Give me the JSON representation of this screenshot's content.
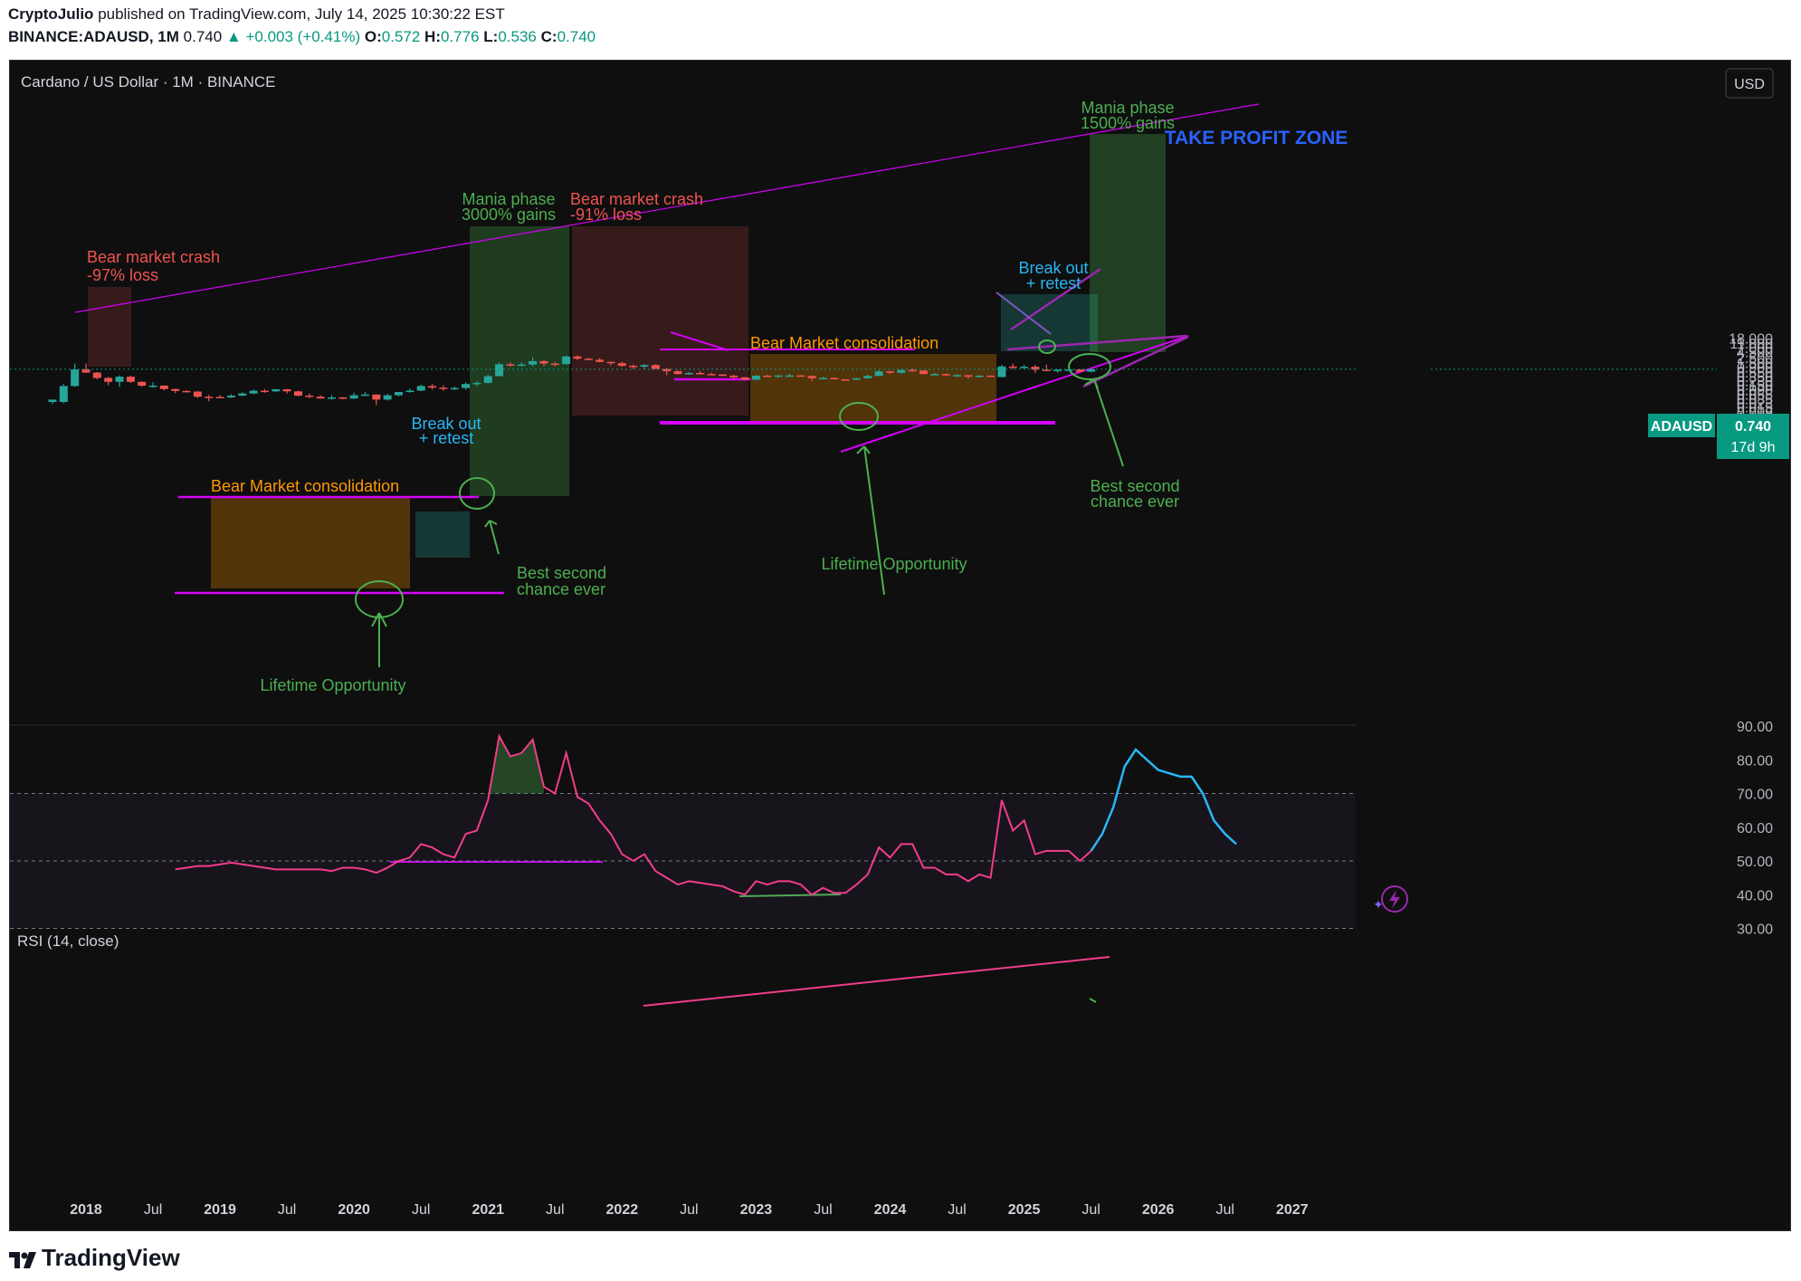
{
  "header": {
    "line1_author": "CryptoJulio",
    "line1_rest": "published on TradingView.com, July 14, 2025 10:30:22 EST",
    "symbol": "BINANCE:ADAUSD, 1M",
    "price": "0.740",
    "change": "+0.003 (+0.41%)",
    "o_label": "O:",
    "o": "0.572",
    "h_label": "H:",
    "h": "0.776",
    "l_label": "L:",
    "l": "0.536",
    "c_label": "C:",
    "c": "0.740"
  },
  "legend_title": "Cardano / US Dollar · 1M · BINANCE",
  "currency_button": "USD",
  "price_badge": {
    "symbol": "ADAUSD",
    "value": "0.740",
    "countdown": "17d 9h"
  },
  "rsi_title": "RSI (14, close)",
  "footer_brand": "TradingView",
  "colors": {
    "up": "#26a69a",
    "down": "#ef5350",
    "rsi": "#f23d8a",
    "rsi_projection": "#29b6f6",
    "trend": "#d500f9",
    "annotation_green": "#4caf50",
    "annotation_red": "#ef5350",
    "annotation_orange": "#ff9800",
    "annotation_cyan": "#29b6f6",
    "take_profit": "#2962ff"
  },
  "annotations": [
    {
      "text": "Bear market crash",
      "color": "red"
    },
    {
      "text": "-97% loss",
      "color": "red"
    },
    {
      "text": "Bear Market consolidation",
      "color": "orange"
    },
    {
      "text": "Break out",
      "color": "cyan"
    },
    {
      "text": "+ retest",
      "color": "cyan"
    },
    {
      "text": "Mania phase",
      "color": "green"
    },
    {
      "text": "3000% gains",
      "color": "green"
    },
    {
      "text": "Bear market crash",
      "color": "red"
    },
    {
      "text": "-91% loss",
      "color": "red"
    },
    {
      "text": "Best second",
      "color": "green"
    },
    {
      "text": "chance ever",
      "color": "green"
    },
    {
      "text": "Lifetime Opportunity",
      "color": "green"
    },
    {
      "text": "Bear Market consolidation",
      "color": "orange"
    },
    {
      "text": "Lifetime Opportunity",
      "color": "green"
    },
    {
      "text": "Break out",
      "color": "cyan"
    },
    {
      "text": "+ retest",
      "color": "cyan"
    },
    {
      "text": "Mania phase",
      "color": "green"
    },
    {
      "text": "1500% gains",
      "color": "green"
    },
    {
      "text": "TAKE PROFIT ZONE",
      "color": "blue"
    },
    {
      "text": "Best second",
      "color": "green"
    },
    {
      "text": "chance ever",
      "color": "green"
    }
  ],
  "chart_data": {
    "type": "candlestick",
    "title": "Cardano / US Dollar · 1M · BINANCE",
    "y_scale": "log",
    "y_ticks": [
      "18.000",
      "11.000",
      "7.000",
      "4.500",
      "2.500",
      "1.500",
      "0.900",
      "0.550",
      "0.350",
      "0.230",
      "0.150",
      "0.090",
      "0.055",
      "0.035",
      "0.023",
      "0.015",
      "0.009",
      "0.005"
    ],
    "x_ticks": [
      "2018",
      "Jul",
      "2019",
      "Jul",
      "2020",
      "Jul",
      "2021",
      "Jul",
      "2022",
      "Jul",
      "2023",
      "Jul",
      "2024",
      "Jul",
      "2025",
      "Jul",
      "2026",
      "Jul",
      "2027"
    ],
    "candles": [
      {
        "d": "2017-10",
        "o": 0.025,
        "h": 0.03,
        "l": 0.02,
        "c": 0.032
      },
      {
        "d": "2017-11",
        "o": 0.025,
        "h": 0.16,
        "l": 0.022,
        "c": 0.13
      },
      {
        "d": "2017-12",
        "o": 0.13,
        "h": 1.33,
        "l": 0.12,
        "c": 0.72
      },
      {
        "d": "2018-01",
        "o": 0.72,
        "h": 1.33,
        "l": 0.5,
        "c": 0.52
      },
      {
        "d": "2018-02",
        "o": 0.52,
        "h": 0.55,
        "l": 0.26,
        "c": 0.3
      },
      {
        "d": "2018-03",
        "o": 0.3,
        "h": 0.34,
        "l": 0.14,
        "c": 0.2
      },
      {
        "d": "2018-04",
        "o": 0.2,
        "h": 0.39,
        "l": 0.12,
        "c": 0.34
      },
      {
        "d": "2018-05",
        "o": 0.34,
        "h": 0.38,
        "l": 0.18,
        "c": 0.2
      },
      {
        "d": "2018-06",
        "o": 0.2,
        "h": 0.21,
        "l": 0.12,
        "c": 0.135
      },
      {
        "d": "2018-07",
        "o": 0.135,
        "h": 0.19,
        "l": 0.11,
        "c": 0.135
      },
      {
        "d": "2018-08",
        "o": 0.135,
        "h": 0.14,
        "l": 0.083,
        "c": 0.095
      },
      {
        "d": "2018-09",
        "o": 0.095,
        "h": 0.1,
        "l": 0.063,
        "c": 0.078
      },
      {
        "d": "2018-10",
        "o": 0.078,
        "h": 0.085,
        "l": 0.07,
        "c": 0.073
      },
      {
        "d": "2018-11",
        "o": 0.073,
        "h": 0.078,
        "l": 0.038,
        "c": 0.043
      },
      {
        "d": "2018-12",
        "o": 0.043,
        "h": 0.052,
        "l": 0.027,
        "c": 0.042
      },
      {
        "d": "2019-01",
        "o": 0.042,
        "h": 0.051,
        "l": 0.039,
        "c": 0.04
      },
      {
        "d": "2019-02",
        "o": 0.04,
        "h": 0.055,
        "l": 0.038,
        "c": 0.048
      },
      {
        "d": "2019-03",
        "o": 0.048,
        "h": 0.068,
        "l": 0.046,
        "c": 0.06
      },
      {
        "d": "2019-04",
        "o": 0.06,
        "h": 0.09,
        "l": 0.057,
        "c": 0.08
      },
      {
        "d": "2019-05",
        "o": 0.08,
        "h": 0.095,
        "l": 0.065,
        "c": 0.075
      },
      {
        "d": "2019-06",
        "o": 0.075,
        "h": 0.095,
        "l": 0.07,
        "c": 0.093
      },
      {
        "d": "2019-07",
        "o": 0.093,
        "h": 0.095,
        "l": 0.06,
        "c": 0.075
      },
      {
        "d": "2019-08",
        "o": 0.075,
        "h": 0.08,
        "l": 0.045,
        "c": 0.048
      },
      {
        "d": "2019-09",
        "o": 0.048,
        "h": 0.06,
        "l": 0.038,
        "c": 0.043
      },
      {
        "d": "2019-10",
        "o": 0.043,
        "h": 0.05,
        "l": 0.035,
        "c": 0.036
      },
      {
        "d": "2019-11",
        "o": 0.036,
        "h": 0.05,
        "l": 0.032,
        "c": 0.04
      },
      {
        "d": "2019-12",
        "o": 0.04,
        "h": 0.042,
        "l": 0.033,
        "c": 0.036
      },
      {
        "d": "2020-01",
        "o": 0.036,
        "h": 0.065,
        "l": 0.033,
        "c": 0.05
      },
      {
        "d": "2020-02",
        "o": 0.05,
        "h": 0.072,
        "l": 0.048,
        "c": 0.054
      },
      {
        "d": "2020-03",
        "o": 0.054,
        "h": 0.055,
        "l": 0.018,
        "c": 0.032
      },
      {
        "d": "2020-04",
        "o": 0.032,
        "h": 0.058,
        "l": 0.029,
        "c": 0.05
      },
      {
        "d": "2020-05",
        "o": 0.05,
        "h": 0.062,
        "l": 0.045,
        "c": 0.07
      },
      {
        "d": "2020-06",
        "o": 0.07,
        "h": 0.1,
        "l": 0.065,
        "c": 0.081
      },
      {
        "d": "2020-07",
        "o": 0.081,
        "h": 0.15,
        "l": 0.076,
        "c": 0.13
      },
      {
        "d": "2020-08",
        "o": 0.13,
        "h": 0.16,
        "l": 0.09,
        "c": 0.11
      },
      {
        "d": "2020-09",
        "o": 0.11,
        "h": 0.14,
        "l": 0.08,
        "c": 0.103
      },
      {
        "d": "2020-10",
        "o": 0.103,
        "h": 0.12,
        "l": 0.085,
        "c": 0.106
      },
      {
        "d": "2020-11",
        "o": 0.106,
        "h": 0.19,
        "l": 0.09,
        "c": 0.16
      },
      {
        "d": "2020-12",
        "o": 0.16,
        "h": 0.21,
        "l": 0.13,
        "c": 0.18
      },
      {
        "d": "2021-01",
        "o": 0.18,
        "h": 0.42,
        "l": 0.17,
        "c": 0.36
      },
      {
        "d": "2021-02",
        "o": 0.36,
        "h": 1.48,
        "l": 0.35,
        "c": 1.23
      },
      {
        "d": "2021-03",
        "o": 1.23,
        "h": 1.49,
        "l": 0.97,
        "c": 1.19
      },
      {
        "d": "2021-04",
        "o": 1.19,
        "h": 1.5,
        "l": 1.0,
        "c": 1.2
      },
      {
        "d": "2021-05",
        "o": 1.2,
        "h": 2.47,
        "l": 1.0,
        "c": 1.7
      },
      {
        "d": "2021-06",
        "o": 1.7,
        "h": 1.95,
        "l": 1.0,
        "c": 1.33
      },
      {
        "d": "2021-07",
        "o": 1.33,
        "h": 1.5,
        "l": 1.0,
        "c": 1.25
      },
      {
        "d": "2021-08",
        "o": 1.25,
        "h": 3.0,
        "l": 1.2,
        "c": 2.75
      },
      {
        "d": "2021-09",
        "o": 2.75,
        "h": 3.1,
        "l": 1.9,
        "c": 2.2
      },
      {
        "d": "2021-10",
        "o": 2.2,
        "h": 2.4,
        "l": 1.9,
        "c": 1.97
      },
      {
        "d": "2021-11",
        "o": 1.97,
        "h": 2.35,
        "l": 1.5,
        "c": 1.57
      },
      {
        "d": "2021-12",
        "o": 1.57,
        "h": 1.66,
        "l": 1.1,
        "c": 1.37
      },
      {
        "d": "2022-01",
        "o": 1.37,
        "h": 1.6,
        "l": 0.95,
        "c": 1.05
      },
      {
        "d": "2022-02",
        "o": 1.05,
        "h": 1.18,
        "l": 0.75,
        "c": 0.96
      },
      {
        "d": "2022-03",
        "o": 0.96,
        "h": 1.25,
        "l": 0.77,
        "c": 1.14
      },
      {
        "d": "2022-04",
        "o": 1.14,
        "h": 1.24,
        "l": 0.75,
        "c": 0.76
      },
      {
        "d": "2022-05",
        "o": 0.76,
        "h": 0.87,
        "l": 0.4,
        "c": 0.6
      },
      {
        "d": "2022-06",
        "o": 0.6,
        "h": 0.68,
        "l": 0.42,
        "c": 0.45
      },
      {
        "d": "2022-07",
        "o": 0.45,
        "h": 0.56,
        "l": 0.42,
        "c": 0.5
      },
      {
        "d": "2022-08",
        "o": 0.5,
        "h": 0.6,
        "l": 0.44,
        "c": 0.45
      },
      {
        "d": "2022-09",
        "o": 0.45,
        "h": 0.51,
        "l": 0.42,
        "c": 0.43
      },
      {
        "d": "2022-10",
        "o": 0.43,
        "h": 0.44,
        "l": 0.36,
        "c": 0.38
      },
      {
        "d": "2022-11",
        "o": 0.38,
        "h": 0.42,
        "l": 0.29,
        "c": 0.32
      },
      {
        "d": "2022-12",
        "o": 0.32,
        "h": 0.33,
        "l": 0.24,
        "c": 0.25
      },
      {
        "d": "2023-01",
        "o": 0.25,
        "h": 0.4,
        "l": 0.24,
        "c": 0.38
      },
      {
        "d": "2023-02",
        "o": 0.38,
        "h": 0.41,
        "l": 0.34,
        "c": 0.36
      },
      {
        "d": "2023-03",
        "o": 0.36,
        "h": 0.39,
        "l": 0.3,
        "c": 0.39
      },
      {
        "d": "2023-04",
        "o": 0.39,
        "h": 0.46,
        "l": 0.37,
        "c": 0.39
      },
      {
        "d": "2023-05",
        "o": 0.39,
        "h": 0.4,
        "l": 0.34,
        "c": 0.37
      },
      {
        "d": "2023-06",
        "o": 0.37,
        "h": 0.39,
        "l": 0.22,
        "c": 0.29
      },
      {
        "d": "2023-07",
        "o": 0.29,
        "h": 0.34,
        "l": 0.28,
        "c": 0.3
      },
      {
        "d": "2023-08",
        "o": 0.3,
        "h": 0.31,
        "l": 0.25,
        "c": 0.26
      },
      {
        "d": "2023-09",
        "o": 0.26,
        "h": 0.27,
        "l": 0.24,
        "c": 0.25
      },
      {
        "d": "2023-10",
        "o": 0.25,
        "h": 0.3,
        "l": 0.24,
        "c": 0.29
      },
      {
        "d": "2023-11",
        "o": 0.29,
        "h": 0.41,
        "l": 0.28,
        "c": 0.37
      },
      {
        "d": "2023-12",
        "o": 0.37,
        "h": 0.68,
        "l": 0.36,
        "c": 0.59
      },
      {
        "d": "2024-01",
        "o": 0.59,
        "h": 0.63,
        "l": 0.45,
        "c": 0.51
      },
      {
        "d": "2024-02",
        "o": 0.51,
        "h": 0.69,
        "l": 0.47,
        "c": 0.68
      },
      {
        "d": "2024-03",
        "o": 0.68,
        "h": 0.81,
        "l": 0.57,
        "c": 0.64
      },
      {
        "d": "2024-04",
        "o": 0.64,
        "h": 0.66,
        "l": 0.43,
        "c": 0.45
      },
      {
        "d": "2024-05",
        "o": 0.45,
        "h": 0.5,
        "l": 0.41,
        "c": 0.45
      },
      {
        "d": "2024-06",
        "o": 0.45,
        "h": 0.47,
        "l": 0.37,
        "c": 0.39
      },
      {
        "d": "2024-07",
        "o": 0.39,
        "h": 0.46,
        "l": 0.36,
        "c": 0.4
      },
      {
        "d": "2024-08",
        "o": 0.4,
        "h": 0.4,
        "l": 0.28,
        "c": 0.34
      },
      {
        "d": "2024-09",
        "o": 0.34,
        "h": 0.4,
        "l": 0.32,
        "c": 0.38
      },
      {
        "d": "2024-10",
        "o": 0.38,
        "h": 0.39,
        "l": 0.33,
        "c": 0.33
      },
      {
        "d": "2024-11",
        "o": 0.33,
        "h": 1.15,
        "l": 0.32,
        "c": 0.98
      },
      {
        "d": "2024-12",
        "o": 0.98,
        "h": 1.33,
        "l": 0.76,
        "c": 0.85
      },
      {
        "d": "2025-01",
        "o": 0.85,
        "h": 1.16,
        "l": 0.81,
        "c": 0.95
      },
      {
        "d": "2025-02",
        "o": 0.95,
        "h": 1.17,
        "l": 0.5,
        "c": 0.7
      },
      {
        "d": "2025-03",
        "o": 0.7,
        "h": 1.2,
        "l": 0.6,
        "c": 0.67
      },
      {
        "d": "2025-04",
        "o": 0.67,
        "h": 0.73,
        "l": 0.51,
        "c": 0.7
      },
      {
        "d": "2025-05",
        "o": 0.7,
        "h": 0.86,
        "l": 0.66,
        "c": 0.71
      },
      {
        "d": "2025-06",
        "o": 0.71,
        "h": 0.74,
        "l": 0.51,
        "c": 0.572
      },
      {
        "d": "2025-07",
        "o": 0.572,
        "h": 0.776,
        "l": 0.536,
        "c": 0.74
      }
    ],
    "rsi": {
      "name": "RSI (14, close)",
      "y_ticks": [
        90,
        80,
        70,
        60,
        50,
        40,
        30
      ],
      "levels": [
        70,
        50,
        30
      ],
      "values": [
        [
          "2018-09",
          47.5
        ],
        [
          "2018-10",
          48
        ],
        [
          "2018-11",
          48.5
        ],
        [
          "2018-12",
          48.5
        ],
        [
          "2019-01",
          49
        ],
        [
          "2019-02",
          49.5
        ],
        [
          "2019-03",
          49
        ],
        [
          "2019-04",
          48.5
        ],
        [
          "2019-05",
          48
        ],
        [
          "2019-06",
          47.5
        ],
        [
          "2019-07",
          47.5
        ],
        [
          "2019-08",
          47.5
        ],
        [
          "2019-09",
          47.5
        ],
        [
          "2019-10",
          47.5
        ],
        [
          "2019-11",
          47
        ],
        [
          "2019-12",
          48
        ],
        [
          "2020-01",
          48
        ],
        [
          "2020-02",
          47.5
        ],
        [
          "2020-03",
          46.5
        ],
        [
          "2020-04",
          48
        ],
        [
          "2020-05",
          50
        ],
        [
          "2020-06",
          51
        ],
        [
          "2020-07",
          55
        ],
        [
          "2020-08",
          54
        ],
        [
          "2020-09",
          52
        ],
        [
          "2020-10",
          51
        ],
        [
          "2020-11",
          58
        ],
        [
          "2020-12",
          59
        ],
        [
          "2021-01",
          68
        ],
        [
          "2021-02",
          87
        ],
        [
          "2021-03",
          81
        ],
        [
          "2021-04",
          82
        ],
        [
          "2021-05",
          86
        ],
        [
          "2021-06",
          72
        ],
        [
          "2021-07",
          70
        ],
        [
          "2021-08",
          82
        ],
        [
          "2021-09",
          69
        ],
        [
          "2021-10",
          67
        ],
        [
          "2021-11",
          62
        ],
        [
          "2021-12",
          58
        ],
        [
          "2022-01",
          52
        ],
        [
          "2022-02",
          50
        ],
        [
          "2022-03",
          52
        ],
        [
          "2022-04",
          47
        ],
        [
          "2022-05",
          45
        ],
        [
          "2022-06",
          43
        ],
        [
          "2022-07",
          44
        ],
        [
          "2022-08",
          43.5
        ],
        [
          "2022-09",
          43
        ],
        [
          "2022-10",
          42.5
        ],
        [
          "2022-11",
          41
        ],
        [
          "2022-12",
          40
        ],
        [
          "2023-01",
          44
        ],
        [
          "2023-02",
          43
        ],
        [
          "2023-03",
          44
        ],
        [
          "2023-04",
          44
        ],
        [
          "2023-05",
          43
        ],
        [
          "2023-06",
          40
        ],
        [
          "2023-07",
          42
        ],
        [
          "2023-08",
          40.5
        ],
        [
          "2023-09",
          40.5
        ],
        [
          "2023-10",
          43
        ],
        [
          "2023-11",
          46
        ],
        [
          "2023-12",
          54
        ],
        [
          "2024-01",
          51
        ],
        [
          "2024-02",
          55
        ],
        [
          "2024-03",
          55
        ],
        [
          "2024-04",
          48
        ],
        [
          "2024-05",
          48
        ],
        [
          "2024-06",
          46
        ],
        [
          "2024-07",
          46
        ],
        [
          "2024-08",
          44
        ],
        [
          "2024-09",
          46
        ],
        [
          "2024-10",
          45
        ],
        [
          "2024-11",
          68
        ],
        [
          "2024-12",
          59
        ],
        [
          "2025-01",
          62
        ],
        [
          "2025-02",
          52
        ],
        [
          "2025-03",
          53
        ],
        [
          "2025-04",
          53
        ],
        [
          "2025-05",
          53
        ],
        [
          "2025-06",
          50
        ],
        [
          "2025-07",
          53
        ]
      ],
      "projection": [
        [
          "2025-07",
          53
        ],
        [
          "2025-08",
          58
        ],
        [
          "2025-09",
          66
        ],
        [
          "2025-10",
          78
        ],
        [
          "2025-11",
          83
        ],
        [
          "2025-12",
          80
        ],
        [
          "2026-01",
          77
        ],
        [
          "2026-02",
          76
        ],
        [
          "2026-03",
          75
        ],
        [
          "2026-04",
          75
        ],
        [
          "2026-05",
          70
        ],
        [
          "2026-06",
          62
        ],
        [
          "2026-07",
          58
        ],
        [
          "2026-08",
          55
        ]
      ]
    }
  }
}
